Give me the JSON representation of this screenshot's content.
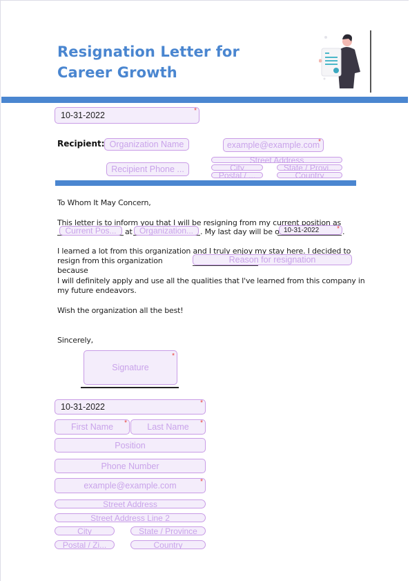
{
  "document": {
    "title_line1": "Resignation Letter for",
    "title_line2": "Career Growth",
    "accent_color": "#4a86d0",
    "field_border_color": "#c89be6",
    "field_fill_color": "#f4edfb",
    "required_marker": "*"
  },
  "header": {
    "date_value": "10-31-2022"
  },
  "recipient": {
    "label": "Recipient:",
    "organization_placeholder": "Organization Name",
    "email_placeholder": "example@example.com",
    "phone_placeholder": "Recipient Phone ...",
    "street_placeholder": "Street Address",
    "city_placeholder": "City",
    "state_placeholder": "State / Provi...",
    "postal_placeholder": "Postal / ...",
    "country_placeholder": "Country"
  },
  "letter": {
    "salutation": "To Whom It May Concern,",
    "p1_text": "This letter is to inform you that I will be resigning from my current position as",
    "p1_position_placeholder": "Current Pos...",
    "p1_at": "at",
    "p1_org_placeholder": "Organization...",
    "p1_lastday": ". My last day will be on",
    "p1_date_value": "10-31-2022",
    "p1_end": ".",
    "p2_line1": "I learned a lot from this organization and I truly enjoy my stay here. I decided to",
    "p2_line2": "resign from this organization because",
    "p2_reason_placeholder": "Reason for resignation",
    "p3_line1": "I will definitely apply and use all the qualities that I've learned from this company in",
    "p3_line2": "my future endeavors.",
    "p4": "Wish the organization all the best!",
    "closing": "Sincerely,"
  },
  "sender": {
    "signature_placeholder": "Signature",
    "date_value": "10-31-2022",
    "first_name_placeholder": "First Name",
    "last_name_placeholder": "Last Name",
    "position_placeholder": "Position",
    "phone_placeholder": "Phone Number",
    "email_placeholder": "example@example.com",
    "street_placeholder": "Street Address",
    "street2_placeholder": "Street Address Line 2",
    "city_placeholder": "City",
    "state_placeholder": "State / Province",
    "postal_placeholder": "Postal / Zi...",
    "country_placeholder": "Country"
  }
}
